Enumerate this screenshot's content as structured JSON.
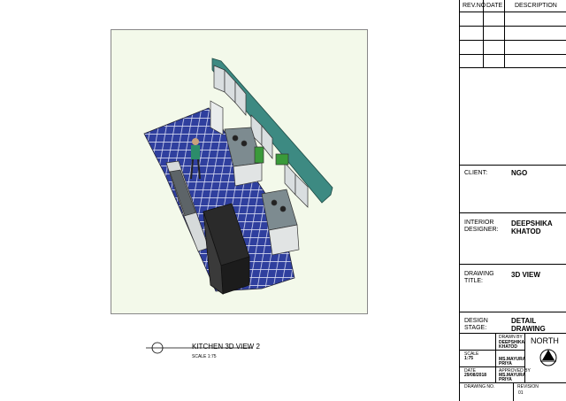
{
  "revision_table": {
    "headers": {
      "rev_no": "REV.NO",
      "date": "DATE",
      "description": "DESCRIPTION"
    }
  },
  "client": {
    "label": "CLIENT:",
    "value": "NGO"
  },
  "designer": {
    "label_line1": "INTERIOR",
    "label_line2": "DESIGNER:",
    "value_line1": "DEEPSHIKA",
    "value_line2": "KHATOD"
  },
  "drawing_title": {
    "label_line1": "DRAWING",
    "label_line2": "TITLE:",
    "value": "3D VIEW"
  },
  "design_stage": {
    "label_line1": "DESIGN",
    "label_line2": "STAGE:",
    "value_line1": "DETAIL",
    "value_line2": "DRAWING"
  },
  "drawn_by": {
    "label": "DRAWN BY",
    "value_line1": "DEEPSHIKA",
    "value_line2": "KHATOD"
  },
  "scale": {
    "label": "SCALE",
    "value": "1:75"
  },
  "checked_by": {
    "value_line1": "MS.MAYURA",
    "value_line2": "PRIYA"
  },
  "date": {
    "label": "DATE",
    "value": "29/08/2018"
  },
  "approved_by": {
    "label": "APPROVED BY",
    "value_line1": "MS.MAYURA",
    "value_line2": "PRIYA"
  },
  "north": {
    "label": "NORTH"
  },
  "drawing_no": {
    "label": "DRAWING NO."
  },
  "revision": {
    "label": "REVISION",
    "value": "01"
  },
  "caption": {
    "title": "KITCHEN 3D VIEW 2",
    "scale": "SCALE 1:75"
  }
}
